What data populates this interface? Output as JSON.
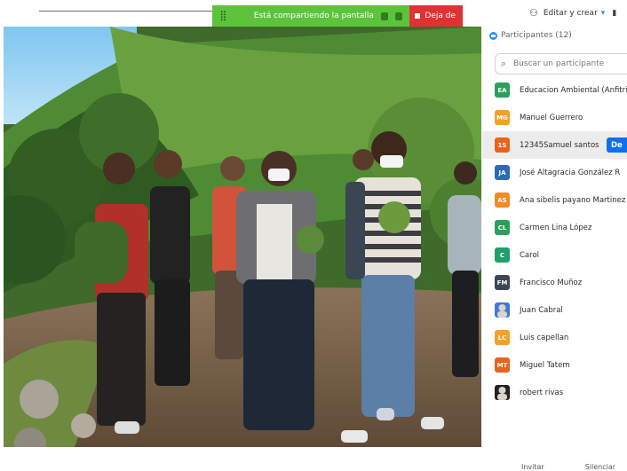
{
  "share_bar": {
    "message": "Está compartiendo la pantalla",
    "stop_label": "Deja de"
  },
  "top_right": {
    "label": "Editar y crear"
  },
  "participants": {
    "header": "Participantes (12)",
    "search_placeholder": "Buscar un participante",
    "items": [
      {
        "initials": "EA",
        "name": "Educacion Ambiental (Anfitrión)",
        "color": "#2aa05a"
      },
      {
        "initials": "MG",
        "name": "Manuel Guerrero",
        "color": "#f2a22c"
      },
      {
        "initials": "1S",
        "name": "12345Samuel santos",
        "color": "#e8641e",
        "action": "De"
      },
      {
        "initials": "JA",
        "name": "José Altagracia González R",
        "color": "#2c6cb4"
      },
      {
        "initials": "AS",
        "name": "Ana sibelis payano Martinez",
        "color": "#f08c28"
      },
      {
        "initials": "CL",
        "name": "Carmen Lina López",
        "color": "#2aa05a"
      },
      {
        "initials": "C",
        "name": "Carol",
        "color": "#1fa06a"
      },
      {
        "initials": "FM",
        "name": "Francisco Muñoz",
        "color": "#3c4656"
      },
      {
        "initials": "",
        "name": "Juan Cabral",
        "color": "#3d7bd0",
        "photo": true
      },
      {
        "initials": "LC",
        "name": "Luis capellan",
        "color": "#f2a22c"
      },
      {
        "initials": "MT",
        "name": "Miguel Tatem",
        "color": "#e8641e"
      },
      {
        "initials": "",
        "name": "robert rivas",
        "color": "#222222",
        "photo": true
      }
    ],
    "footer": {
      "invite": "Invitar",
      "mute_all": "Silenciar"
    }
  },
  "colors": {
    "share_green": "#5ec33c",
    "stop_red": "#e03232",
    "accent_blue": "#0e71eb"
  }
}
